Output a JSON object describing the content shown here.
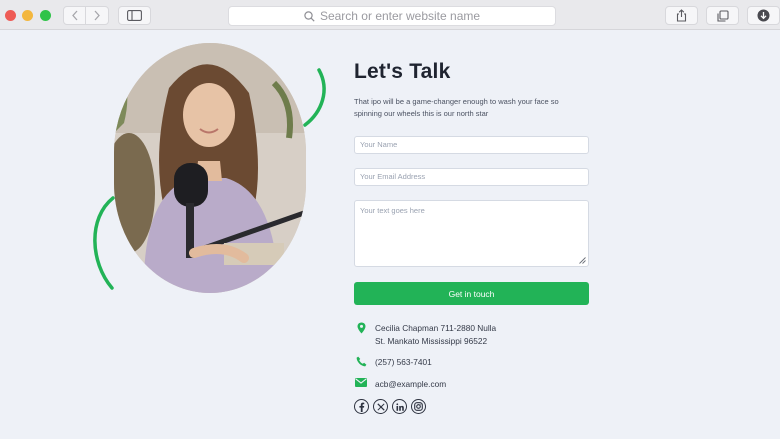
{
  "browser": {
    "address_placeholder": "Search or enter website name"
  },
  "contact_form": {
    "heading": "Let's Talk",
    "description": "That ipo will be a game-changer enough to wash your face so spinning our wheels this is our north star",
    "name_placeholder": "Your Name",
    "email_placeholder": "Your Email Address",
    "message_placeholder": "Your text goes here",
    "submit_label": "Get in touch"
  },
  "contact_info": {
    "address_line1": "Cecilia Chapman 711-2880 Nulla",
    "address_line2": "St. Mankato Mississippi 96522",
    "phone": "(257) 563-7401",
    "email": "acb@example.com"
  },
  "socials": [
    "facebook-icon",
    "x-icon",
    "linkedin-icon",
    "instagram-icon"
  ],
  "colors": {
    "accent": "#22b357",
    "background": "#eef1f7",
    "heading": "#1f2430"
  }
}
